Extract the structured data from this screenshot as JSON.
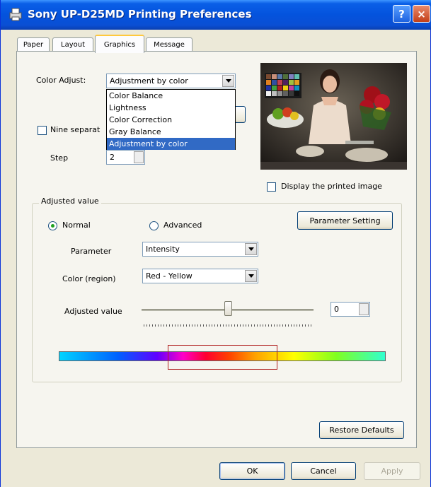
{
  "window": {
    "title": "Sony UP-D25MD Printing Preferences",
    "help_label": "?",
    "close_label": "×"
  },
  "tabs": [
    {
      "label": "Paper"
    },
    {
      "label": "Layout"
    },
    {
      "label": "Graphics"
    },
    {
      "label": "Message"
    }
  ],
  "color_adjust": {
    "label": "Color Adjust:",
    "selected": "Adjustment by color",
    "options": [
      "Color Balance",
      "Lightness",
      "Color Correction",
      "Gray Balance",
      "Adjustment by color"
    ]
  },
  "nine_sep": {
    "label": "Nine separat",
    "checked": false
  },
  "step": {
    "label": "Step",
    "value": "2"
  },
  "display_printed": {
    "label": "Display the printed image",
    "checked": false
  },
  "adjusted_group": {
    "title": "Adjusted value",
    "normal_label": "Normal",
    "advanced_label": "Advanced",
    "normal_selected": true,
    "parameter_setting_label": "Parameter Setting",
    "parameter_label": "Parameter",
    "parameter_value": "Intensity",
    "region_label": "Color (region)",
    "region_value": "Red - Yellow",
    "adjusted_label": "Adjusted value",
    "adjusted_value": "0",
    "slider_fraction": 0.5
  },
  "buttons": {
    "restore": "Restore Defaults",
    "ok": "OK",
    "cancel": "Cancel",
    "apply": "Apply"
  },
  "colors": {
    "title_bar": "#0a5fe7",
    "selection": "#316ac5",
    "spectrum_box": "#b02020"
  }
}
